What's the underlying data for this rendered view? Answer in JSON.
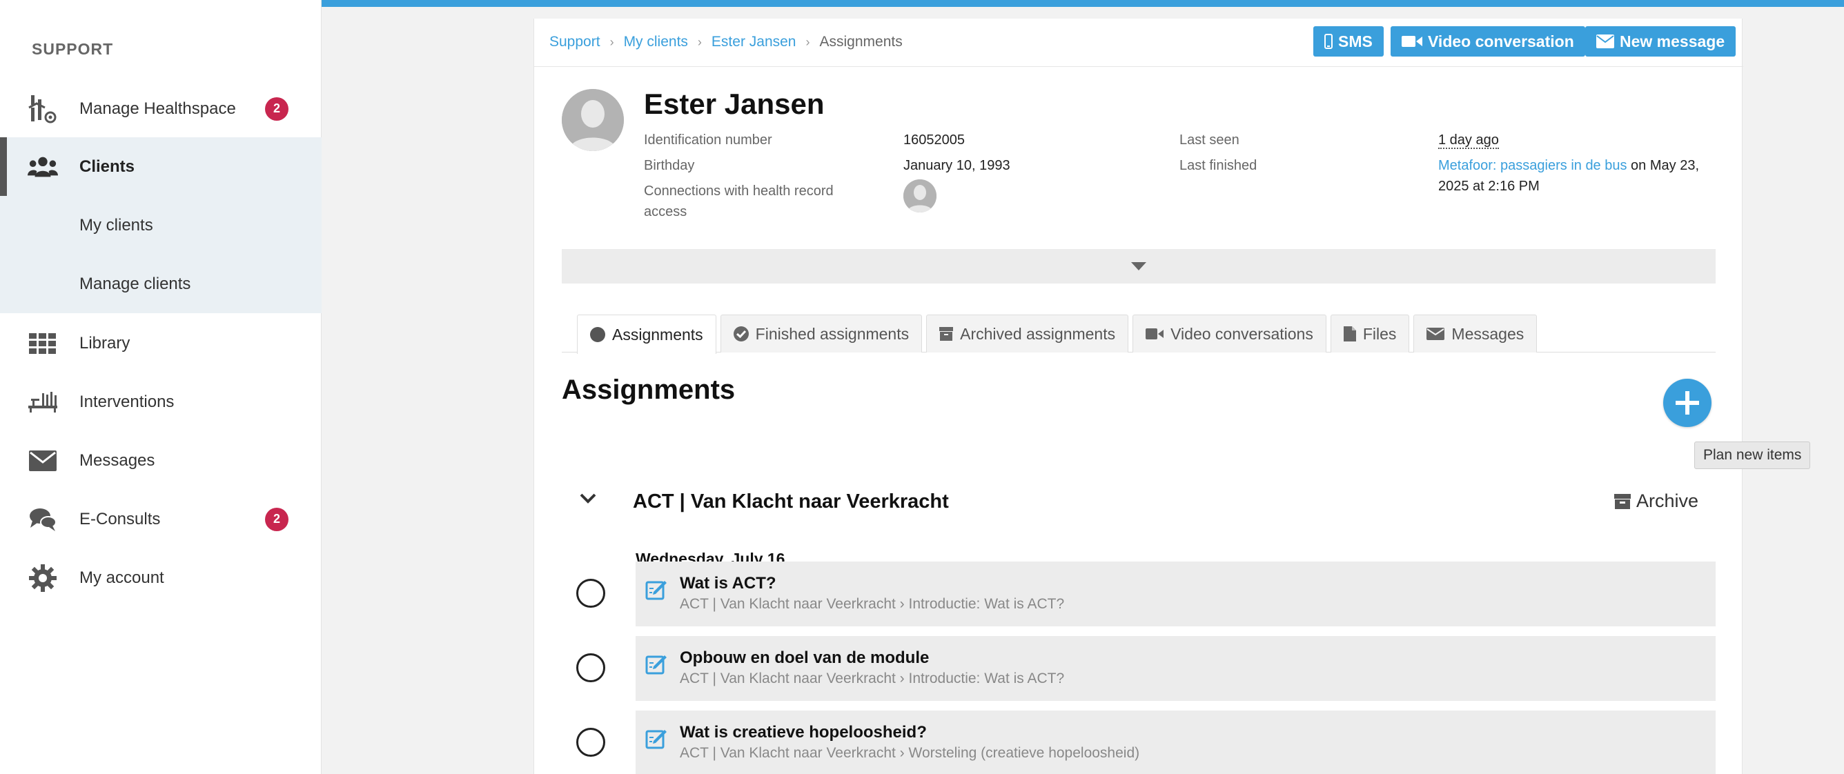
{
  "sidebar": {
    "heading": "SUPPORT",
    "items": [
      {
        "label": "Manage Healthspace",
        "icon": "healthspace-icon",
        "badge": "2"
      },
      {
        "label": "Clients",
        "icon": "users-icon"
      },
      {
        "label": "My clients"
      },
      {
        "label": "Manage clients"
      },
      {
        "label": "Library",
        "icon": "grid-icon"
      },
      {
        "label": "Interventions",
        "icon": "interventions-icon"
      },
      {
        "label": "Messages",
        "icon": "envelope-icon"
      },
      {
        "label": "E-Consults",
        "icon": "chat-icon",
        "badge": "2"
      },
      {
        "label": "My account",
        "icon": "gear-icon"
      }
    ]
  },
  "breadcrumb": {
    "items": [
      "Support",
      "My clients",
      "Ester Jansen"
    ],
    "current": "Assignments"
  },
  "actions": {
    "sms": "SMS",
    "video": "Video conversation",
    "message": "New message"
  },
  "client": {
    "name": "Ester Jansen",
    "id_label": "Identification number",
    "id_value": "16052005",
    "birthday_label": "Birthday",
    "birthday_value": "January 10, 1993",
    "connections_label": "Connections with health record access",
    "last_seen_label": "Last seen",
    "last_seen_value": "1 day ago",
    "last_finished_label": "Last finished",
    "last_finished_link": "Metafoor: passagiers in de bus",
    "last_finished_suffix": " on May 23, 2025 at 2:16 PM"
  },
  "tabs": [
    {
      "label": "Assignments",
      "icon": "circle-icon"
    },
    {
      "label": "Finished assignments",
      "icon": "check-circle-icon"
    },
    {
      "label": "Archived assignments",
      "icon": "archive-icon"
    },
    {
      "label": "Video conversations",
      "icon": "video-icon"
    },
    {
      "label": "Files",
      "icon": "file-icon"
    },
    {
      "label": "Messages",
      "icon": "envelope-icon"
    }
  ],
  "section": {
    "title": "Assignments",
    "plan_tooltip": "Plan new items"
  },
  "group": {
    "title": "ACT | Van Klacht naar Veerkracht",
    "archive_label": "Archive",
    "date": "Wednesday, July 16",
    "assignments": [
      {
        "title": "Wat is ACT?",
        "path": "ACT | Van Klacht naar Veerkracht › Introductie: Wat is ACT?"
      },
      {
        "title": "Opbouw en doel van de module",
        "path": "ACT | Van Klacht naar Veerkracht › Introductie: Wat is ACT?"
      },
      {
        "title": "Wat is creatieve hopeloosheid?",
        "path": "ACT | Van Klacht naar Veerkracht › Worsteling (creatieve hopeloosheid)"
      }
    ]
  },
  "colors": {
    "accent": "#3a9fdc",
    "badge": "#c8264f"
  }
}
